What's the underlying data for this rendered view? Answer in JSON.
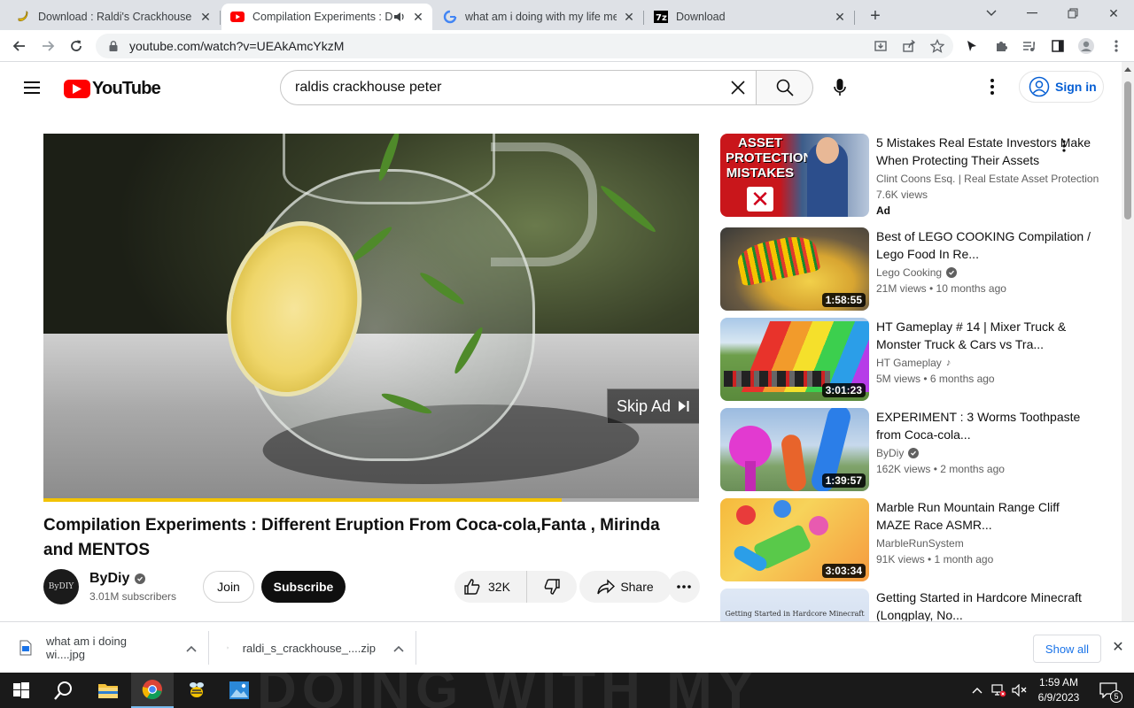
{
  "browser": {
    "tabs": [
      {
        "title": "Download : Raldi's Crackhouse [B",
        "icon": "banana-icon"
      },
      {
        "title": "Compilation Experiments : D",
        "icon": "youtube-icon",
        "active": true
      },
      {
        "title": "what am i doing with my life me",
        "icon": "google-icon"
      },
      {
        "title": "Download",
        "icon": "7zip-icon"
      }
    ],
    "url": "youtube.com/watch?v=UEAkAmcYkzM"
  },
  "youtube": {
    "logo_text": "YouTube",
    "search_query": "raldis crackhouse peter",
    "signin_label": "Sign in"
  },
  "player": {
    "skip_label": "Skip Ad",
    "ad_progress": 0.79,
    "accent": "#f2c200"
  },
  "video": {
    "title": "Compilation Experiments : Different Eruption From Coca-cola,Fanta , Mirinda and MENTOS",
    "channel": "ByDiy",
    "avatar_text": "ByDIY",
    "subscribers": "3.01M subscribers",
    "join_label": "Join",
    "subscribe_label": "Subscribe",
    "likes": "32K",
    "share_label": "Share"
  },
  "recommendations": [
    {
      "title": "5 Mistakes Real Estate Investors Make When Protecting Their Assets",
      "channel": "Clint Coons Esq. | Real Estate Asset Protection",
      "meta": "7.6K views",
      "ad": "Ad",
      "thumb_text": "ASSET PROTECTION MISTAKES"
    },
    {
      "title": "Best of LEGO COOKING Compilation / Lego Food In Re...",
      "channel": "Lego Cooking",
      "meta": "21M views  •  10 months ago",
      "duration": "1:58:55"
    },
    {
      "title": "HT Gameplay # 14 | Mixer Truck & Monster Truck & Cars vs Tra...",
      "channel": "HT Gameplay",
      "meta": "5M views  •  6 months ago",
      "duration": "3:01:23"
    },
    {
      "title": "EXPERIMENT : 3 Worms Toothpaste from Coca-cola...",
      "channel": "ByDiy",
      "meta": "162K views  •  2 months ago",
      "duration": "1:39:57"
    },
    {
      "title": "Marble Run Mountain Range Cliff MAZE Race ASMR...",
      "channel": "MarbleRunSystem",
      "meta": "91K views  •  1 month ago",
      "duration": "3:03:34"
    },
    {
      "title": "Getting Started in Hardcore Minecraft (Longplay, No...",
      "thumb_text": "Getting Started in Hardcore Minecraft"
    }
  ],
  "downloads": {
    "items": [
      {
        "name": "what am i doing wi....jpg"
      },
      {
        "name": "raldi_s_crackhouse_....zip"
      }
    ],
    "show_all": "Show all"
  },
  "taskbar": {
    "time": "1:59 AM",
    "date": "6/9/2023",
    "notifications": "5",
    "wallpaper_text": "DOING WITH MY"
  }
}
